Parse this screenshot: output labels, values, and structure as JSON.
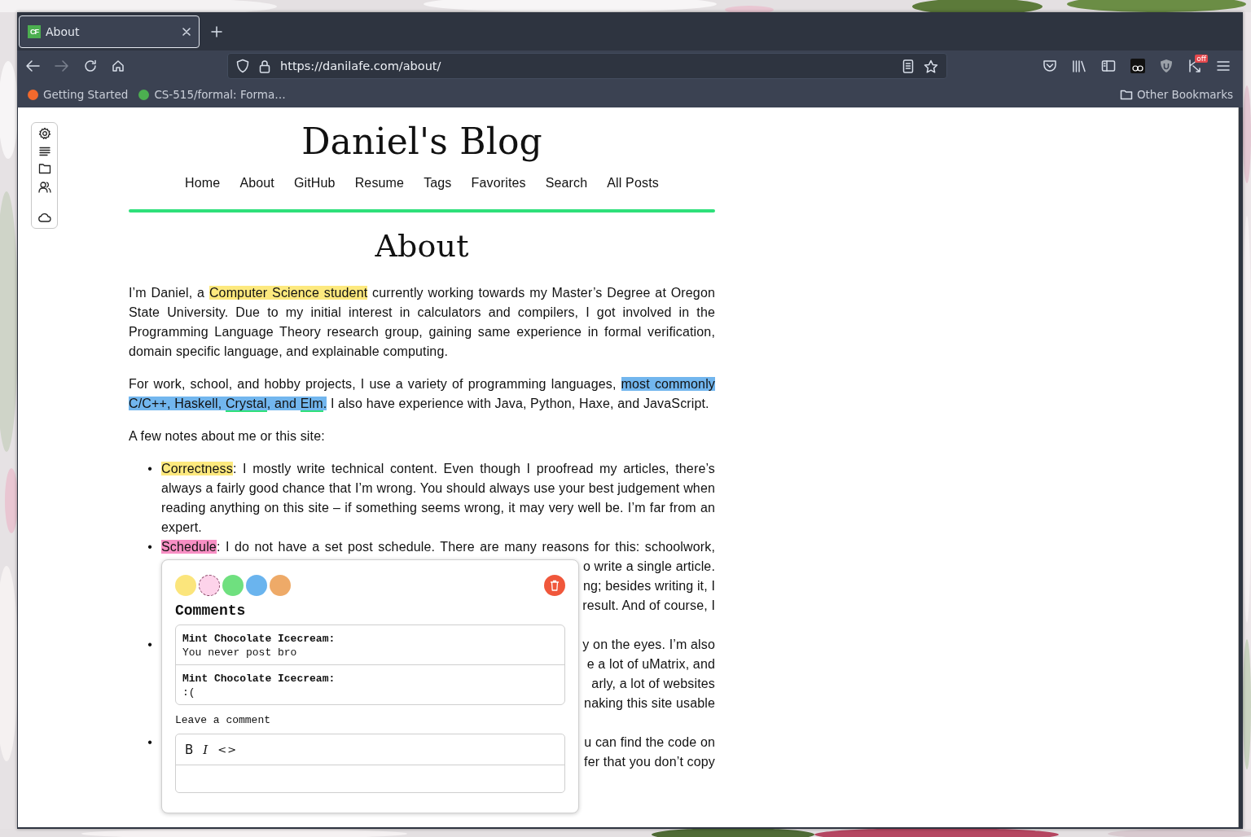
{
  "browser": {
    "tabs": [
      {
        "favicon_text": "CF",
        "title": "About",
        "selected": true
      }
    ],
    "forward": {
      "disabled": true
    },
    "address": "https://danilafe.com/about/",
    "extension_badge": "off",
    "bookmarks": [
      {
        "label": "Getting Started",
        "color": "#f2692c"
      },
      {
        "label": "CS-515/formal: Forma…",
        "color": "#4caf50"
      }
    ],
    "other_bookmarks": "Other Bookmarks"
  },
  "site": {
    "title": "Daniel's Blog",
    "nav": [
      "Home",
      "About",
      "GitHub",
      "Resume",
      "Tags",
      "Favorites",
      "Search",
      "All Posts"
    ]
  },
  "page": {
    "heading": "About",
    "paragraphs": [
      {
        "segments": [
          {
            "text": "I’m Daniel, a "
          },
          {
            "text": "Computer Science student",
            "color": "#fde97e"
          },
          {
            "text": " currently working towards my Master’s Degree at Oregon State University. Due to my initial interest in calculators and compilers, I got involved in the Programming Language Theory research group, gaining same experience in formal verification, domain specific language, and explainable computing."
          }
        ]
      },
      {
        "segments": [
          {
            "text": "For work, school, and hobby projects, I use a variety of programming languages, "
          },
          {
            "text": "most commonly C/C++, Haskell, ",
            "color": "#72b6ee"
          },
          {
            "text": "Crystal",
            "color": "#72b6ee",
            "kind": "link"
          },
          {
            "text": ", and ",
            "color": "#72b6ee"
          },
          {
            "text": "Elm",
            "color": "#72b6ee",
            "kind": "link"
          },
          {
            "text": ".",
            "color": "#72b6ee"
          },
          {
            "text": " I also have experience with Java, Python, Haxe, and JavaScript."
          }
        ]
      },
      {
        "segments": [
          {
            "text": "A few notes about me or this site:"
          }
        ]
      }
    ],
    "list": [
      {
        "kind": "full",
        "bullet": "•",
        "segments": [
          {
            "text": "Correctness",
            "color": "#fde97e"
          },
          {
            "text": ": I mostly write technical content. Even though I proofread my articles, there’s always a fairly good chance that I’m wrong. You should always use your best judgement when reading anything on this site – if something seems wrong, it may very well be. I’m far from an expert."
          }
        ]
      },
      {
        "kind": "covered",
        "bullet": "•",
        "segments": [
          {
            "text": "Schedule",
            "color": "#f78fc4"
          },
          {
            "text": ": I do not have a set post schedule. There are many reasons for this: schoolwork,"
          }
        ],
        "fragments": [
          "o write a single article.",
          "ng; besides writing it, I",
          "result. And of course, I"
        ]
      },
      {
        "kind": "covered",
        "bullet": "•",
        "fragments": [
          "y on the eyes. I’m also",
          "e a lot of uMatrix, and",
          "arly, a lot of websites",
          "naking this site usable"
        ]
      },
      {
        "kind": "covered",
        "bullet": "•",
        "fragments": [
          "u can find the code on",
          "fer that you don’t copy"
        ]
      }
    ]
  },
  "popup": {
    "swatches": [
      {
        "color": "#fbe57c",
        "selected": false
      },
      {
        "color": "#fdd3ea",
        "selected": true
      },
      {
        "color": "#6fe07f",
        "selected": false
      },
      {
        "color": "#6ab4ee",
        "selected": false
      },
      {
        "color": "#eeaa68",
        "selected": false
      }
    ],
    "title": "Comments",
    "comments": [
      {
        "author": "Mint Chocolate Icecream:",
        "text": "You never post bro"
      },
      {
        "author": "Mint Chocolate Icecream:",
        "text": ":("
      }
    ],
    "leave_label": "Leave a comment",
    "editor_tools": [
      {
        "label": "B",
        "kind": "bold"
      },
      {
        "label": "I",
        "kind": "italic"
      },
      {
        "label": "<>",
        "kind": "code"
      }
    ]
  }
}
